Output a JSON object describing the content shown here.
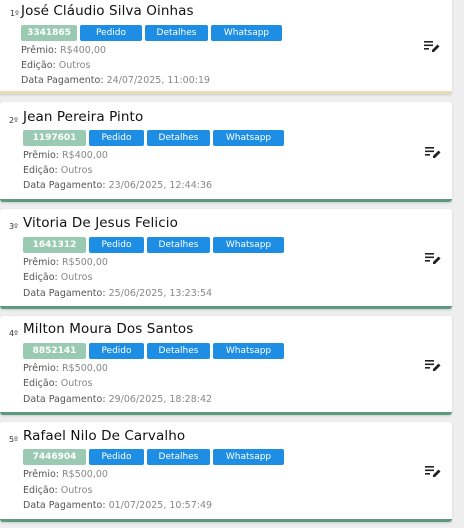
{
  "labels": {
    "pedido": "Pedido",
    "detalhes": "Detalhes",
    "whatsapp": "Whatsapp",
    "premio": "Prêmio:",
    "edicao": "Edição:",
    "data_pagamento": "Data Pagamento:"
  },
  "winners": [
    {
      "position": "1º",
      "name": "José Cláudio Silva Oinhas",
      "code": "3341865",
      "premio": "R$400,00",
      "edicao": "Outros",
      "data_pagamento": "24/07/2025, 11:00:19"
    },
    {
      "position": "2º",
      "name": "Jean Pereira Pinto",
      "code": "1197601",
      "premio": "R$400,00",
      "edicao": "Outros",
      "data_pagamento": "23/06/2025, 12:44:36"
    },
    {
      "position": "3º",
      "name": "Vitoria De Jesus Felicio",
      "code": "1641312",
      "premio": "R$500,00",
      "edicao": "Outros",
      "data_pagamento": "25/06/2025, 13:23:54"
    },
    {
      "position": "4º",
      "name": "Milton Moura Dos Santos",
      "code": "8852141",
      "premio": "R$500,00",
      "edicao": "Outros",
      "data_pagamento": "29/06/2025, 18:28:42"
    },
    {
      "position": "5º",
      "name": "Rafael Nilo De Carvalho",
      "code": "7446904",
      "premio": "R$500,00",
      "edicao": "Outros",
      "data_pagamento": "01/07/2025, 10:57:49"
    }
  ],
  "icons": {
    "edit": "edit-note-icon"
  },
  "colors": {
    "code_badge": "#9acbb2",
    "button": "#1e8ee5",
    "first_card_border": "#e8ddb2",
    "card_border": "#5c9b80"
  }
}
